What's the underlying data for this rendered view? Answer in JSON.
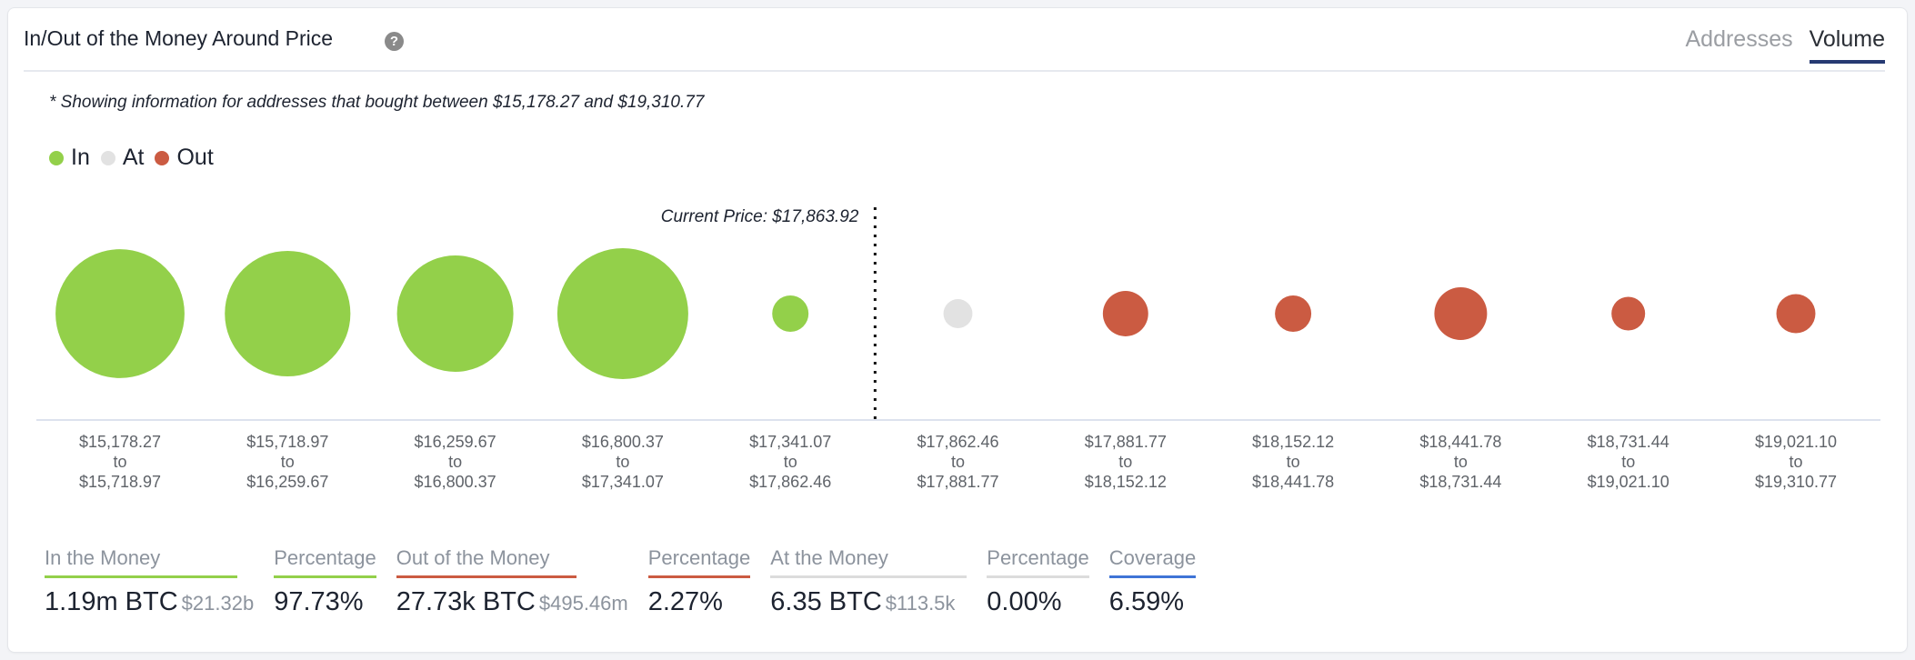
{
  "header": {
    "title": "In/Out of the Money Around Price",
    "help_icon": "question-circle-icon",
    "tabs": [
      {
        "label": "Addresses",
        "active": false
      },
      {
        "label": "Volume",
        "active": true
      }
    ]
  },
  "subtitle": "* Showing information for addresses that bought between $15,178.27 and $19,310.77",
  "colors": {
    "in": "#93d04a",
    "at": "#e2e2e2",
    "out": "#cb5b42",
    "coverage": "#3f74d6"
  },
  "legend": [
    {
      "label": "In",
      "key": "in"
    },
    {
      "label": "At",
      "key": "at"
    },
    {
      "label": "Out",
      "key": "out"
    }
  ],
  "chart_data": {
    "type": "scatter",
    "subtype": "bubble",
    "title": "In/Out of the Money Around Price",
    "current_price_label": "Current Price: $17,863.92",
    "current_price": 17863.92,
    "categories": [
      {
        "from": "$15,178.27",
        "to": "$15,718.97"
      },
      {
        "from": "$15,718.97",
        "to": "$16,259.67"
      },
      {
        "from": "$16,259.67",
        "to": "$16,800.37"
      },
      {
        "from": "$16,800.37",
        "to": "$17,341.07"
      },
      {
        "from": "$17,341.07",
        "to": "$17,862.46"
      },
      {
        "from": "$17,862.46",
        "to": "$17,881.77"
      },
      {
        "from": "$17,881.77",
        "to": "$18,152.12"
      },
      {
        "from": "$18,152.12",
        "to": "$18,441.78"
      },
      {
        "from": "$18,441.78",
        "to": "$18,731.44"
      },
      {
        "from": "$18,731.44",
        "to": "$19,021.10"
      },
      {
        "from": "$19,021.10",
        "to": "$19,310.77"
      }
    ],
    "range_connector": "to",
    "status": [
      "in",
      "in",
      "in",
      "in",
      "in",
      "at",
      "out",
      "out",
      "out",
      "out",
      "out"
    ],
    "relative_volume": [
      0.97,
      0.92,
      0.79,
      1.0,
      0.077,
      0.049,
      0.12,
      0.077,
      0.162,
      0.066,
      0.089
    ],
    "current_price_after_index": 4,
    "legend_position": "top-left"
  },
  "stats": [
    {
      "label": "In the Money",
      "value": "1.19m BTC",
      "sub": "$21.32b",
      "key": "in"
    },
    {
      "label": "Percentage",
      "value": "97.73%",
      "sub": "",
      "key": "in"
    },
    {
      "label": "Out of the Money",
      "value": "27.73k BTC",
      "sub": "$495.46m",
      "key": "out"
    },
    {
      "label": "Percentage",
      "value": "2.27%",
      "sub": "",
      "key": "out"
    },
    {
      "label": "At the Money",
      "value": "6.35 BTC",
      "sub": "$113.5k",
      "key": "at"
    },
    {
      "label": "Percentage",
      "value": "0.00%",
      "sub": "",
      "key": "at"
    },
    {
      "label": "Coverage",
      "value": "6.59%",
      "sub": "",
      "key": "coverage"
    }
  ]
}
